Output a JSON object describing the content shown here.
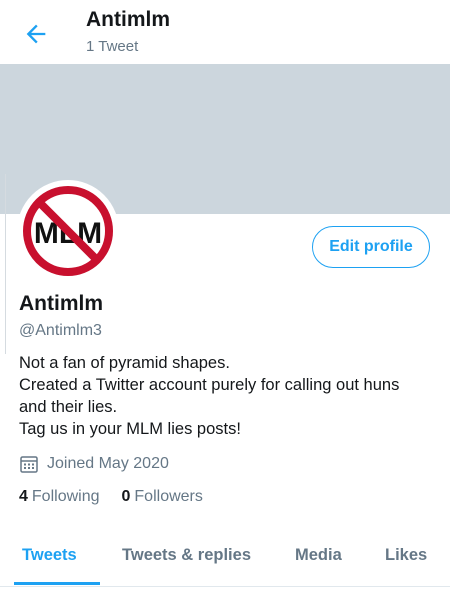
{
  "header": {
    "title": "Antimlm",
    "tweet_count": "1 Tweet",
    "back_icon": "back-arrow-icon"
  },
  "avatar": {
    "text": "MLM",
    "colors": {
      "ring": "#c8102e",
      "text": "#111111"
    }
  },
  "profile": {
    "edit_label": "Edit profile",
    "name": "Antimlm",
    "handle": "@Antimlm3",
    "bio": [
      "Not a fan of pyramid shapes.",
      "Created a Twitter account purely for calling out huns",
      "and their lies.",
      "Tag us in your MLM lies posts!"
    ],
    "joined": "Joined May 2020",
    "following_count": "4",
    "following_label": "Following",
    "followers_count": "0",
    "followers_label": "Followers"
  },
  "tabs": [
    {
      "label": "Tweets",
      "active": true
    },
    {
      "label": "Tweets & replies",
      "active": false
    },
    {
      "label": "Media",
      "active": false
    },
    {
      "label": "Likes",
      "active": false
    }
  ],
  "colors": {
    "accent": "#1da1f2",
    "banner": "#ccd6dd",
    "secondary_text": "#657786"
  }
}
